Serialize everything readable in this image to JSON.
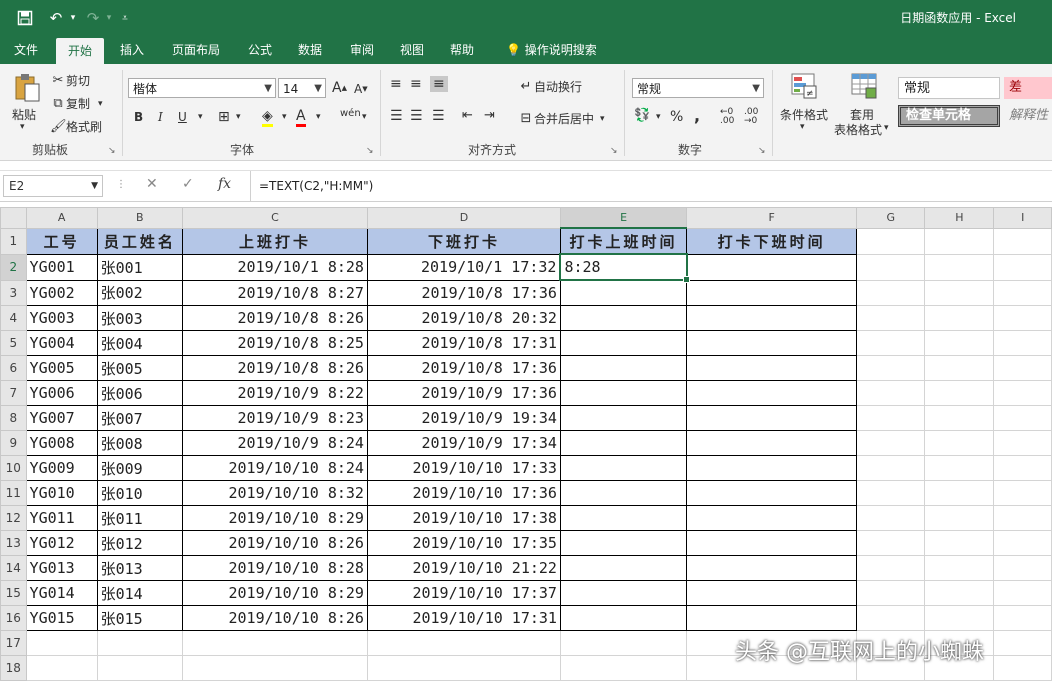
{
  "window": {
    "title": "日期函数应用 - Excel",
    "quick_access": {
      "save_icon": "save-icon",
      "undo_icon": "undo-icon",
      "redo_icon": "redo-icon",
      "customize_icon": "customize-icon"
    }
  },
  "ribbon_tabs": [
    "文件",
    "开始",
    "插入",
    "页面布局",
    "公式",
    "数据",
    "审阅",
    "视图",
    "帮助",
    "操作说明搜索"
  ],
  "ribbon": {
    "clipboard": {
      "paste": "粘贴",
      "cut": "剪切",
      "copy": "复制",
      "format_painter": "格式刷",
      "label": "剪贴板"
    },
    "font": {
      "name": "楷体",
      "size": "14",
      "bold": "B",
      "italic": "I",
      "underline": "U",
      "label": "字体"
    },
    "alignment": {
      "wrap": "自动换行",
      "merge": "合并后居中",
      "label": "对齐方式"
    },
    "number": {
      "format": "常规",
      "percent": "%",
      "comma": ",",
      "label": "数字"
    },
    "styles": {
      "conditional": "条件格式",
      "table_line1": "套用",
      "table_line2": "表格格式",
      "normal": "常规",
      "bad": "差",
      "check_cell": "检查单元格",
      "explanatory": "解释性"
    }
  },
  "formula_bar": {
    "name_box": "E2",
    "formula": "=TEXT(C2,\"H:MM\")"
  },
  "sheet": {
    "columns": [
      "A",
      "B",
      "C",
      "D",
      "E",
      "F",
      "G",
      "H",
      "I"
    ],
    "headers": [
      "工号",
      "员工姓名",
      "上班打卡",
      "下班打卡",
      "打卡上班时间",
      "打卡下班时间"
    ],
    "rows": [
      {
        "n": "2",
        "a": "YG001",
        "b": "张001",
        "c": "2019/10/1  8:28",
        "d": "2019/10/1  17:32",
        "e": "8:28"
      },
      {
        "n": "3",
        "a": "YG002",
        "b": "张002",
        "c": "2019/10/8  8:27",
        "d": "2019/10/8  17:36",
        "e": ""
      },
      {
        "n": "4",
        "a": "YG003",
        "b": "张003",
        "c": "2019/10/8  8:26",
        "d": "2019/10/8  20:32",
        "e": ""
      },
      {
        "n": "5",
        "a": "YG004",
        "b": "张004",
        "c": "2019/10/8  8:25",
        "d": "2019/10/8  17:31",
        "e": ""
      },
      {
        "n": "6",
        "a": "YG005",
        "b": "张005",
        "c": "2019/10/8  8:26",
        "d": "2019/10/8  17:36",
        "e": ""
      },
      {
        "n": "7",
        "a": "YG006",
        "b": "张006",
        "c": "2019/10/9  8:22",
        "d": "2019/10/9  17:36",
        "e": ""
      },
      {
        "n": "8",
        "a": "YG007",
        "b": "张007",
        "c": "2019/10/9  8:23",
        "d": "2019/10/9  19:34",
        "e": ""
      },
      {
        "n": "9",
        "a": "YG008",
        "b": "张008",
        "c": "2019/10/9  8:24",
        "d": "2019/10/9  17:34",
        "e": ""
      },
      {
        "n": "10",
        "a": "YG009",
        "b": "张009",
        "c": "2019/10/10  8:24",
        "d": "2019/10/10  17:33",
        "e": ""
      },
      {
        "n": "11",
        "a": "YG010",
        "b": "张010",
        "c": "2019/10/10  8:32",
        "d": "2019/10/10  17:36",
        "e": ""
      },
      {
        "n": "12",
        "a": "YG011",
        "b": "张011",
        "c": "2019/10/10  8:29",
        "d": "2019/10/10  17:38",
        "e": ""
      },
      {
        "n": "13",
        "a": "YG012",
        "b": "张012",
        "c": "2019/10/10  8:26",
        "d": "2019/10/10  17:35",
        "e": ""
      },
      {
        "n": "14",
        "a": "YG013",
        "b": "张013",
        "c": "2019/10/10  8:28",
        "d": "2019/10/10  21:22",
        "e": ""
      },
      {
        "n": "15",
        "a": "YG014",
        "b": "张014",
        "c": "2019/10/10  8:29",
        "d": "2019/10/10  17:37",
        "e": ""
      },
      {
        "n": "16",
        "a": "YG015",
        "b": "张015",
        "c": "2019/10/10  8:26",
        "d": "2019/10/10  17:31",
        "e": ""
      }
    ],
    "empty_rows": [
      "17",
      "18"
    ]
  },
  "watermark": "头条 @互联网上的小蜘蛛",
  "colors": {
    "excel_green": "#217346",
    "header_fill": "#b4c6e7",
    "bad_fill": "#ffc7ce",
    "check_cell_fill": "#a5a5a5"
  }
}
